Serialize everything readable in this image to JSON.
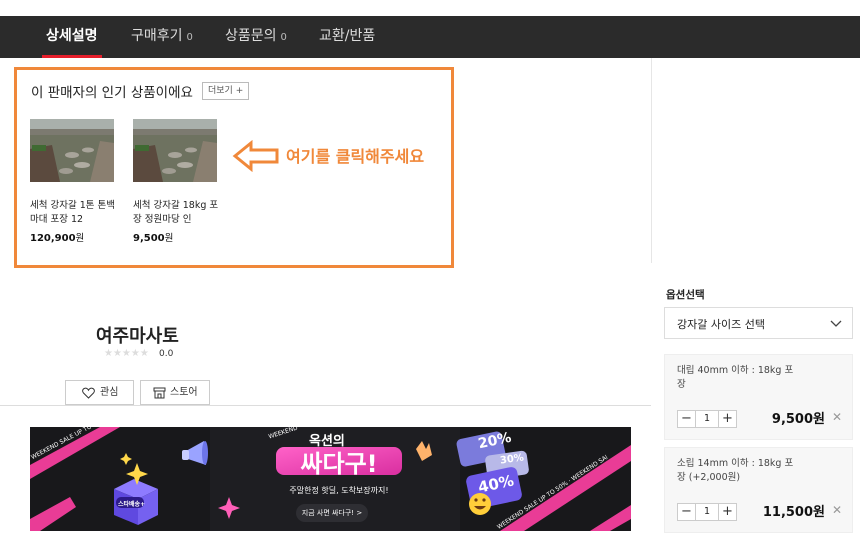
{
  "nav": {
    "tabs": [
      {
        "label": "상세설명",
        "count": ""
      },
      {
        "label": "구매후기",
        "count": "0"
      },
      {
        "label": "상품문의",
        "count": "0"
      },
      {
        "label": "교환/반품",
        "count": ""
      }
    ],
    "active_index": 0,
    "accent": "#e61e2b"
  },
  "popular": {
    "title": "이 판매자의 인기 상품이에요",
    "more_label": "더보기 +",
    "hint": "여기를 클릭해주세요",
    "highlight_color": "#f0883a",
    "products": [
      {
        "name": "세척 강자갈 1톤 톤백마대 포장 12",
        "price": "120,900",
        "unit": "원"
      },
      {
        "name": "세척 강자갈 18kg 포장 정원마당 인",
        "price": "9,500",
        "unit": "원"
      }
    ]
  },
  "seller": {
    "name": "여주마사토",
    "stars": "★★★★★",
    "rating": "0.0",
    "like_label": "관심",
    "store_label": "스토어"
  },
  "banner": {
    "small_title": "옥션의",
    "big_title": "싸다구!",
    "weekend": "WEEKEND",
    "subtitle": "주말한정 핫딜, 도착보장까지!",
    "cta": "지금 사면 싸다구! >",
    "ribbon_text": "WEEKEND SALE UP TO 50% · WEEKEND SALE UP TO 50% · WEEKEND SALE UP TO 50%",
    "tag_20": "20%",
    "tag_30": "30%",
    "tag_40": "40%",
    "box_label": "스타배송+"
  },
  "options": {
    "title": "옵션선택",
    "select_label": "강자갈 사이즈 선택",
    "items": [
      {
        "desc": "대립 40mm 이하 : 18kg 포장",
        "qty": "1",
        "price": "9,500원"
      },
      {
        "desc": "소립 14mm 이하 : 18kg 포장 (+2,000원)",
        "qty": "1",
        "price": "11,500원"
      }
    ]
  }
}
